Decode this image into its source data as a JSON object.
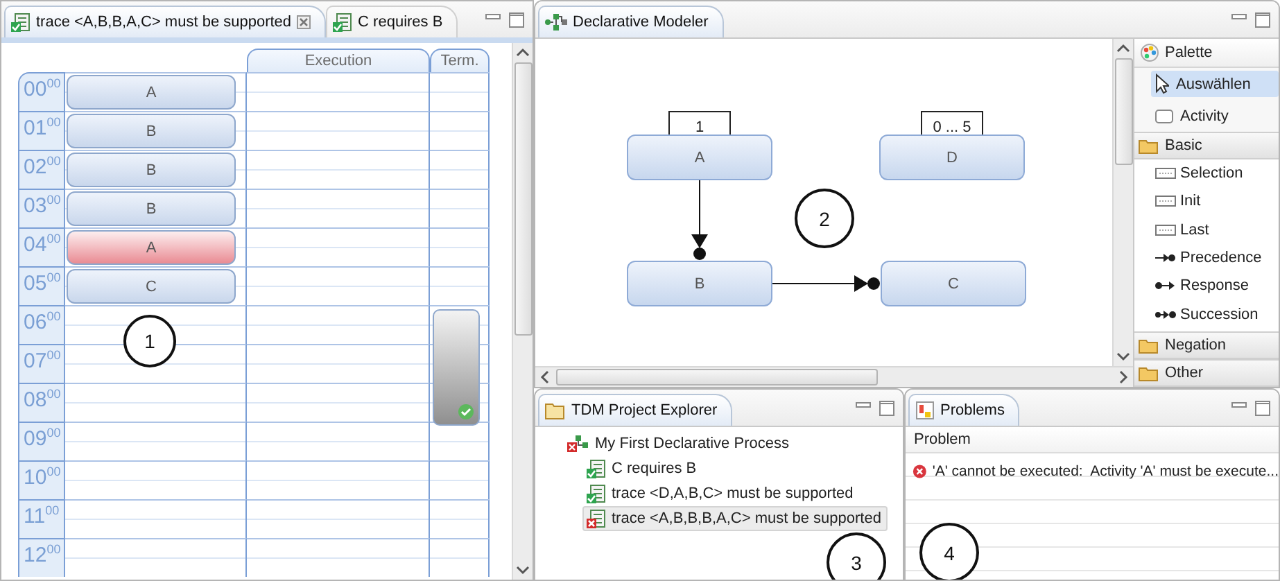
{
  "editor": {
    "tabs": [
      {
        "label": "trace <A,B,B,A,C> must be supported",
        "valid": true,
        "selected": true
      },
      {
        "label": "C requires B",
        "valid": true,
        "selected": false
      }
    ],
    "columns": [
      "Execution",
      "Term."
    ],
    "hours": [
      {
        "hour": "00",
        "minute": "00"
      },
      {
        "hour": "01",
        "minute": "00"
      },
      {
        "hour": "02",
        "minute": "00"
      },
      {
        "hour": "03",
        "minute": "00"
      },
      {
        "hour": "04",
        "minute": "00"
      },
      {
        "hour": "05",
        "minute": "00"
      },
      {
        "hour": "06",
        "minute": "00"
      },
      {
        "hour": "07",
        "minute": "00"
      },
      {
        "hour": "08",
        "minute": "00"
      },
      {
        "hour": "09",
        "minute": "00"
      },
      {
        "hour": "10",
        "minute": "00"
      },
      {
        "hour": "11",
        "minute": "00"
      },
      {
        "hour": "12",
        "minute": "00"
      }
    ],
    "events": [
      {
        "label": "A",
        "violated": false
      },
      {
        "label": "B",
        "violated": false
      },
      {
        "label": "B",
        "violated": false
      },
      {
        "label": "B",
        "violated": false
      },
      {
        "label": "A",
        "violated": true
      },
      {
        "label": "C",
        "violated": false
      }
    ],
    "termination": {
      "satisfied": true
    },
    "marker": "1"
  },
  "modeler": {
    "tab": "Declarative Modeler",
    "nodes": [
      {
        "label": "A",
        "cardinality": "1"
      },
      {
        "label": "D",
        "cardinality": "0 ... 5"
      },
      {
        "label": "B"
      },
      {
        "label": "C"
      }
    ],
    "edges": [
      {
        "kind": "precedence"
      },
      {
        "kind": "precedence"
      }
    ],
    "marker": "2"
  },
  "palette": {
    "title": "Palette",
    "tools": [
      {
        "label": "Auswählen",
        "kind": "select",
        "selected": true
      },
      {
        "label": "Activity",
        "kind": "activity",
        "selected": false
      }
    ],
    "drawers": [
      {
        "label": "Basic",
        "expanded": true,
        "items": [
          {
            "label": "Selection",
            "kind": "selection"
          },
          {
            "label": "Init",
            "kind": "init"
          },
          {
            "label": "Last",
            "kind": "last"
          },
          {
            "label": "Precedence",
            "kind": "precedence"
          },
          {
            "label": "Response",
            "kind": "response"
          },
          {
            "label": "Succession",
            "kind": "succession"
          }
        ]
      },
      {
        "label": "Negation",
        "expanded": false
      },
      {
        "label": "Other",
        "expanded": false
      }
    ]
  },
  "explorer": {
    "tab": "TDM Project Explorer",
    "tree": {
      "label": "My First Declarative Process",
      "valid": false,
      "children": [
        {
          "label": "C requires B",
          "valid": true,
          "selected": false
        },
        {
          "label": "trace <D,A,B,C> must be supported",
          "valid": true,
          "selected": false
        },
        {
          "label": "trace <A,B,B,B,A,C> must be supported",
          "valid": false,
          "selected": true
        }
      ]
    },
    "marker": "3"
  },
  "problems": {
    "tab": "Problems",
    "column": "Problem",
    "rows": [
      {
        "error": true,
        "text": "'A' cannot be executed:  Activity 'A' must be execute..."
      }
    ],
    "marker": "4"
  }
}
